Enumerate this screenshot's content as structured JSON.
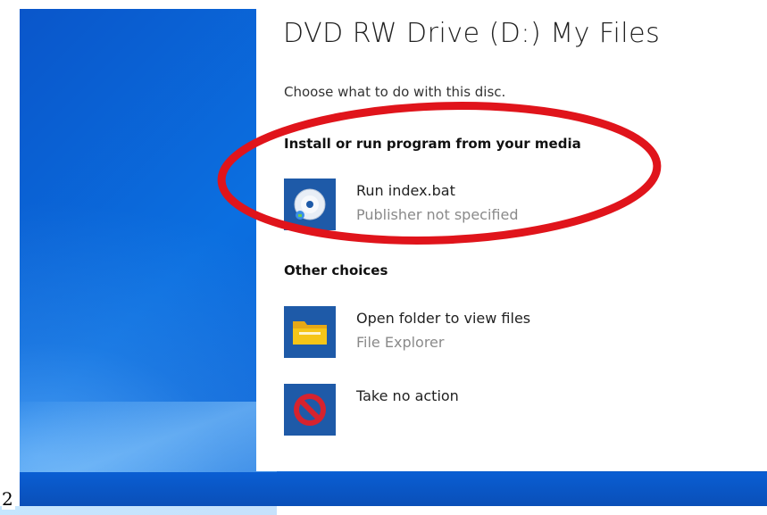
{
  "dialog": {
    "title": "DVD RW Drive (D:) My Files",
    "subtitle": "Choose what to do with this disc.",
    "install_section": {
      "heading": "Install or run program from your media",
      "options": [
        {
          "label": "Run index.bat",
          "sublabel": "Publisher not specified",
          "icon": "disc-icon"
        }
      ]
    },
    "other_section": {
      "heading": "Other choices",
      "options": [
        {
          "label": "Open folder to view files",
          "sublabel": "File Explorer",
          "icon": "folder-icon"
        },
        {
          "label": "Take no action",
          "sublabel": "",
          "icon": "no-action-icon"
        }
      ]
    }
  },
  "annotation": {
    "shape": "ellipse",
    "color": "#e0141b"
  },
  "corner_label": "2",
  "colors": {
    "desktop_blue": "#0a5fd0",
    "tile_blue": "#1e5aa8",
    "folder_yellow": "#f5c518",
    "block_red": "#d6232e"
  }
}
